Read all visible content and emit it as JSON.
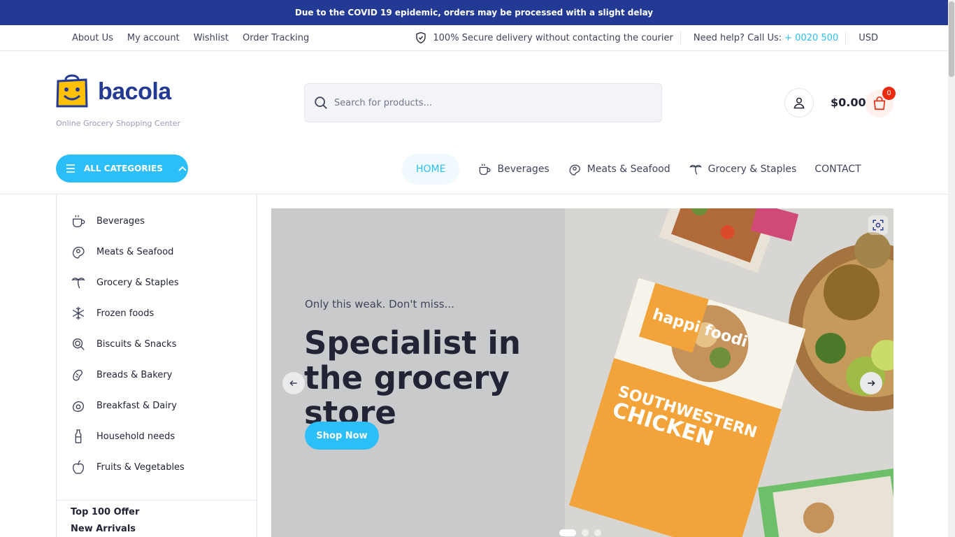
{
  "announcement": "Due to the COVID 19 epidemic, orders may be processed with a slight delay",
  "top_links": [
    "About Us",
    "My account",
    "Wishlist",
    "Order Tracking"
  ],
  "secure_text": "100% Secure delivery without contacting the courier",
  "help_text": "Need help? Call Us:",
  "help_phone": "+ 0020 500",
  "currency": "USD",
  "logo": {
    "name": "bacola",
    "tagline": "Online Grocery Shopping Center"
  },
  "search": {
    "placeholder": "Search for products..."
  },
  "cart": {
    "total": "$0.00",
    "count": "0"
  },
  "all_categories": "ALL CATEGORIES",
  "nav": {
    "home": "HOME",
    "beverages": "Beverages",
    "meats": "Meats & Seafood",
    "grocery": "Grocery & Staples",
    "contact": "CONTACT"
  },
  "sidebar": {
    "categories": [
      "Beverages",
      "Meats & Seafood",
      "Grocery & Staples",
      "Frozen foods",
      "Biscuits & Snacks",
      "Breads & Bakery",
      "Breakfast & Dairy",
      "Household needs",
      "Fruits & Vegetables"
    ],
    "extras": [
      "Top 100 Offer",
      "New Arrivals"
    ]
  },
  "hero": {
    "kicker": "Only this weak. Don't miss...",
    "headline": "Specialist in the grocery store",
    "button": "Shop Now",
    "box_brand": "happi foodi",
    "box_title": "SOUTHWESTERN CHICKEN Street Tacos"
  },
  "colors": {
    "brand_blue": "#233a95",
    "accent": "#2bbef9",
    "cart_badge": "#ea2b0f"
  }
}
